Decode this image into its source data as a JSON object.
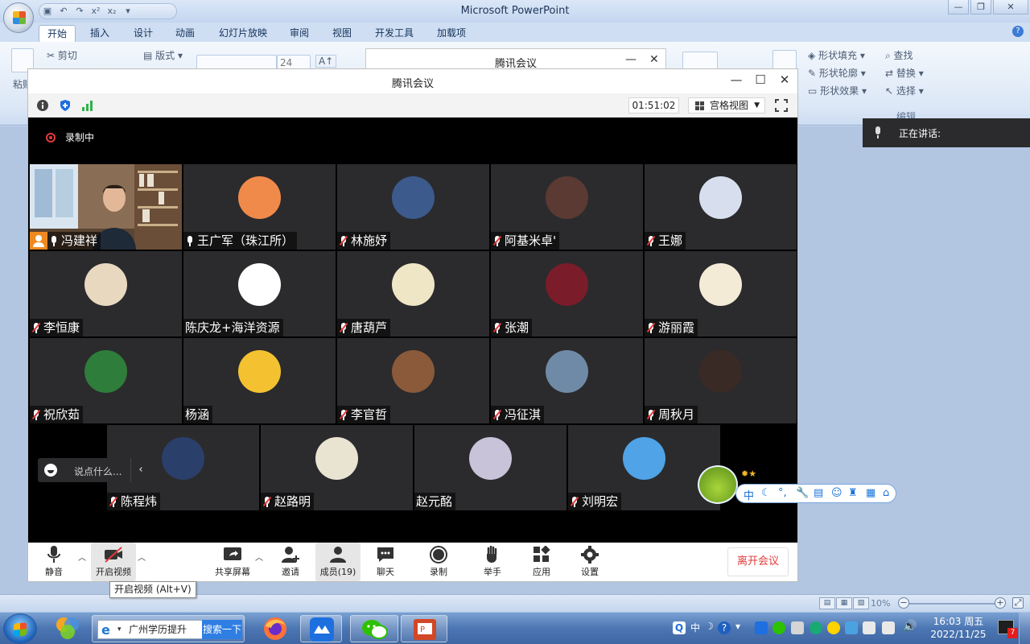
{
  "powerpoint": {
    "title": "Microsoft PowerPoint",
    "tabs": [
      "开始",
      "插入",
      "设计",
      "动画",
      "幻灯片放映",
      "审阅",
      "视图",
      "开发工具",
      "加载项"
    ],
    "ribbon": {
      "cut": "剪切",
      "paste": "粘贴",
      "layout": "版式",
      "font_size": "24",
      "shape_fill": "形状填充",
      "shape_outline": "形状轮廓",
      "shape_effect": "形状效果",
      "find": "查找",
      "replace": "替换",
      "select": "选择",
      "edit_group": "编辑"
    },
    "status": {
      "zoom": "10%"
    }
  },
  "tencent_back": {
    "title": "腾讯会议"
  },
  "speaking": {
    "label": "正在讲话:"
  },
  "meeting": {
    "title": "腾讯会议",
    "timer": "01:51:02",
    "view_mode": "宫格视图",
    "recording_label": "录制中",
    "chat_placeholder": "说点什么...",
    "participants": [
      {
        "name": "冯建祥",
        "mic": "on",
        "host": true,
        "video": true
      },
      {
        "name": "王广军（珠江所）",
        "mic": "on",
        "avatar_color": "#f08a4b"
      },
      {
        "name": "林施妤",
        "mic": "off",
        "avatar_color": "#3c5a8c"
      },
      {
        "name": "阿基米卓'",
        "mic": "off",
        "avatar_color": "#5a3a33"
      },
      {
        "name": "王娜",
        "mic": "off",
        "avatar_color": "#d7dfef"
      },
      {
        "name": "李恒康",
        "mic": "off",
        "avatar_color": "#e8d8c0"
      },
      {
        "name": "陈庆龙+海洋资源",
        "mic": "none",
        "avatar_color": "#ffffff"
      },
      {
        "name": "唐葫芦",
        "mic": "off",
        "avatar_color": "#efe6c6"
      },
      {
        "name": "张潮",
        "mic": "off",
        "avatar_color": "#7a1c2a"
      },
      {
        "name": "游丽霞",
        "mic": "off",
        "avatar_color": "#f3ebd6"
      },
      {
        "name": "祝欣茹",
        "mic": "off",
        "avatar_color": "#2f7d3a"
      },
      {
        "name": "杨涵",
        "mic": "none",
        "avatar_color": "#f4c230"
      },
      {
        "name": "李官哲",
        "mic": "off",
        "avatar_color": "#8a5a3a"
      },
      {
        "name": "冯征淇",
        "mic": "off",
        "avatar_color": "#6f8aa6"
      },
      {
        "name": "周秋月",
        "mic": "off",
        "avatar_color": "#3a2a26"
      },
      {
        "name": "陈程炜",
        "mic": "off",
        "avatar_color": "#2b3f6b"
      },
      {
        "name": "赵路明",
        "mic": "off",
        "avatar_color": "#e9e4d2"
      },
      {
        "name": "赵元酩",
        "mic": "none",
        "avatar_color": "#c9c3d9"
      },
      {
        "name": "刘明宏",
        "mic": "off",
        "avatar_color": "#4fa3e6"
      }
    ],
    "toolbar": {
      "mute": "静音",
      "video": "开启视频",
      "share": "共享屏幕",
      "invite": "邀请",
      "members": "成员(19)",
      "chat": "聊天",
      "record": "录制",
      "raise_hand": "举手",
      "apps": "应用",
      "settings": "设置",
      "leave": "离开会议"
    },
    "tooltip": "开启视频 (Alt+V)"
  },
  "ime": {
    "lang": "中"
  },
  "taskbar": {
    "ie_text": "广州学历提升",
    "ie_search": "搜索一下",
    "ime_lang": "中",
    "time": "16:03 周五",
    "date": "2022/11/25",
    "notif_count": "7"
  }
}
